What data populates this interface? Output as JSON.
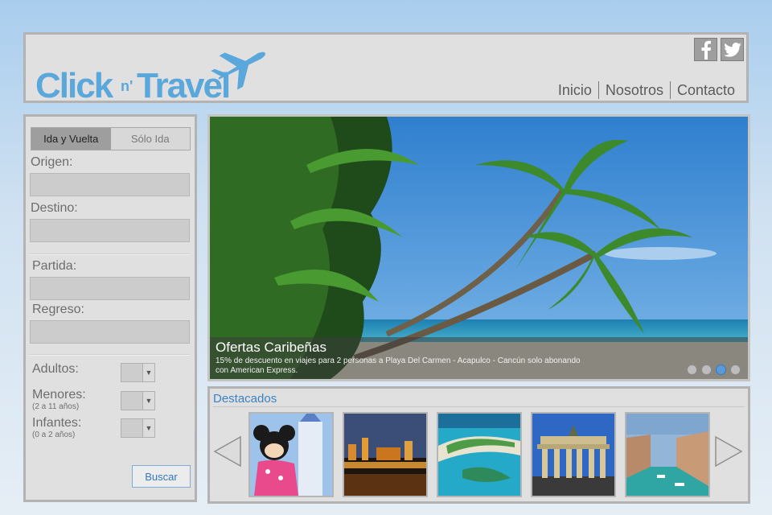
{
  "header": {
    "logo_text": "ClicknTravel",
    "facebook_icon": "facebook-icon",
    "twitter_icon": "twitter-icon",
    "nav": [
      "Inicio",
      "Nosotros",
      "Contacto"
    ]
  },
  "search": {
    "tabs": [
      "Ida y Vuelta",
      "Sólo Ida"
    ],
    "active_tab": "Ida y Vuelta",
    "origin_label": "Origen:",
    "destination_label": "Destino:",
    "departure_label": "Partida:",
    "return_label": "Regreso:",
    "adults_label": "Adultos:",
    "children_label": "Menores:",
    "children_sub": "(2 a 11 años)",
    "infants_label": "Infantes:",
    "infants_sub": "(0 a 2 años)",
    "submit": "Buscar"
  },
  "slider": {
    "title": "Ofertas Caribeñas",
    "text": "15% de descuento en viajes para 2 personas a Playa Del Carmen - Acapulco - Cancún solo abonando con American Express.",
    "dots": 4,
    "active_dot": 3
  },
  "featured": {
    "title": "Destacados",
    "thumbs": [
      "Disney",
      "Ciudad de noche",
      "Playa",
      "Puerta de Brandeburgo",
      "Venecia"
    ]
  },
  "colors": {
    "accent": "#3b82c4",
    "logo": "#5aa7db"
  }
}
